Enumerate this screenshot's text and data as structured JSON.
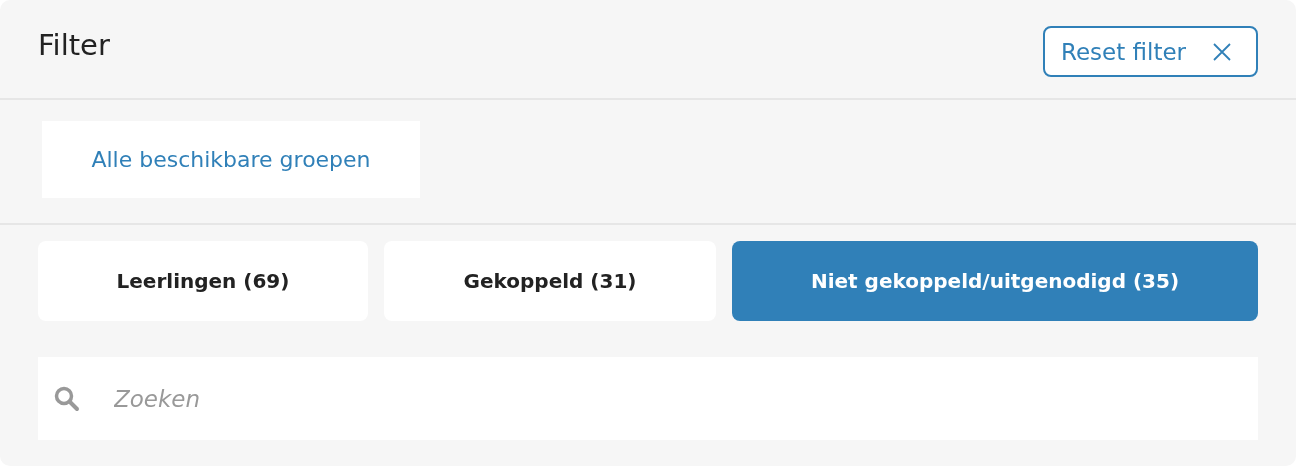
{
  "header": {
    "title": "Filter",
    "reset_button": "Reset filter"
  },
  "group_button": "Alle beschikbare groepen",
  "tabs": [
    {
      "label": "Leerlingen (69)",
      "selected": false
    },
    {
      "label": "Gekoppeld (31)",
      "selected": false
    },
    {
      "label": "Niet gekoppeld/uitgenodigd (35)",
      "selected": true
    }
  ],
  "search": {
    "placeholder": "Zoeken"
  }
}
